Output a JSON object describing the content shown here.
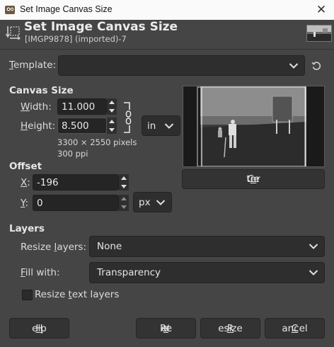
{
  "window": {
    "title": "Set Image Canvas Size",
    "close_glyph": "✕"
  },
  "header": {
    "title": "Set Image Canvas Size",
    "subtitle": "[IMGP9878] (imported)-7"
  },
  "template": {
    "label_prefix": "",
    "label_u": "T",
    "label_rest": "emplate:",
    "value": ""
  },
  "canvas_size": {
    "heading": "Canvas Size",
    "width_label_u": "W",
    "width_label_rest": "idth:",
    "width_value": "11.000",
    "height_label_u": "H",
    "height_label_rest": "eight:",
    "height_value": "8.500",
    "unit": "in",
    "pixels_info": "3300 × 2550 pixels",
    "ppi_info": "300 ppi"
  },
  "offset": {
    "heading": "Offset",
    "x_label_u": "X",
    "x_label_rest": ":",
    "x_value": "-196",
    "y_label_u": "Y",
    "y_label_rest": ":",
    "y_value": "0",
    "unit": "px"
  },
  "center_button": {
    "pre": "Ce",
    "u": "n",
    "post": "ter"
  },
  "layers": {
    "heading": "Layers",
    "resize_label_pre": "Resize ",
    "resize_label_u": "l",
    "resize_label_post": "ayers:",
    "resize_value": "None",
    "fill_label_u": "F",
    "fill_label_rest": "ill with:",
    "fill_value": "Transparency",
    "resize_text_pre": "Resize ",
    "resize_text_u": "t",
    "resize_text_post": "ext layers",
    "resize_text_checked": false
  },
  "buttons": {
    "help_u": "H",
    "help_rest": "elp",
    "reset_pre": "Re",
    "reset_u": "s",
    "reset_post": "et",
    "resize_u": "R",
    "resize_rest": "esize",
    "cancel_u": "C",
    "cancel_rest": "ancel"
  },
  "colors": {
    "background": "#454545",
    "entry": "#252525",
    "title_bar": "#fafafa"
  }
}
